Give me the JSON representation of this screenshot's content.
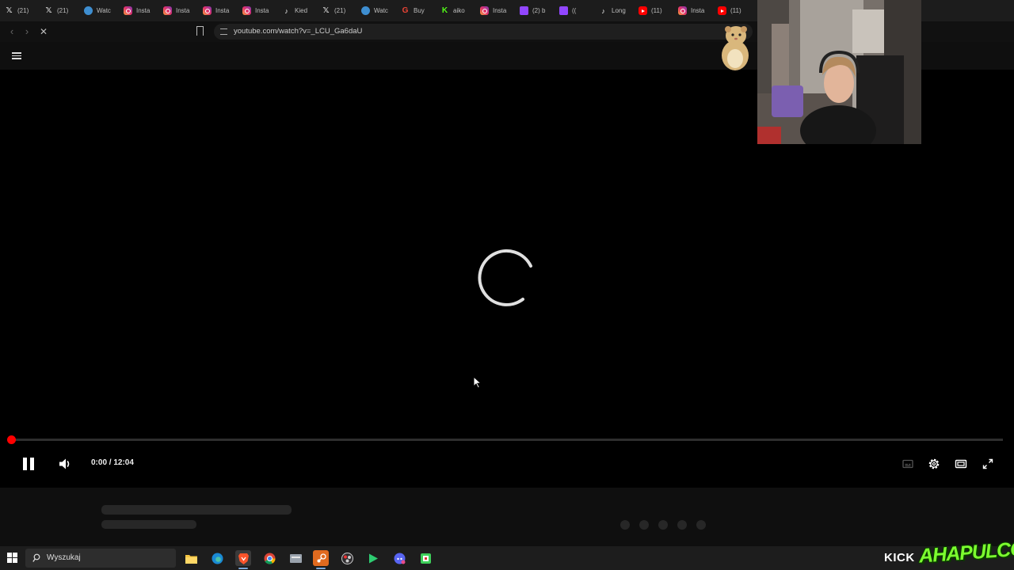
{
  "browser": {
    "tabs": [
      {
        "icon": "x-icon",
        "label": "(21)"
      },
      {
        "icon": "x-icon",
        "label": "(21)"
      },
      {
        "icon": "watch-icon",
        "label": "Watc"
      },
      {
        "icon": "instagram-icon",
        "label": "Insta"
      },
      {
        "icon": "instagram-icon",
        "label": "Insta"
      },
      {
        "icon": "instagram-icon",
        "label": "Insta"
      },
      {
        "icon": "instagram-icon",
        "label": "Insta"
      },
      {
        "icon": "tiktok-icon",
        "label": "Kied"
      },
      {
        "icon": "x-icon",
        "label": "(21)"
      },
      {
        "icon": "watch-icon",
        "label": "Watc"
      },
      {
        "icon": "google-icon",
        "label": "Buy"
      },
      {
        "icon": "kick-icon",
        "label": "aiko"
      },
      {
        "icon": "instagram-icon",
        "label": "Insta"
      },
      {
        "icon": "twitch-icon",
        "label": "(2) b"
      },
      {
        "icon": "twitch-icon",
        "label": "(("
      },
      {
        "icon": "tiktok-icon",
        "label": "Long"
      },
      {
        "icon": "youtube-icon",
        "label": "(11)"
      },
      {
        "icon": "instagram-icon",
        "label": "Insta"
      },
      {
        "icon": "youtube-icon",
        "label": "(11)"
      }
    ],
    "url": "youtube.com/watch?v=_LCU_Ga6daU"
  },
  "player": {
    "time": "0:00 / 12:04",
    "progress_fraction": 0,
    "accent_color": "#ff0000",
    "loading": true
  },
  "taskbar": {
    "search_placeholder": "Wyszukaj",
    "apps": [
      "file-explorer-icon",
      "edge-icon",
      "brave-icon",
      "chrome-icon",
      "file-manager-icon",
      "steam-icon",
      "obs-icon",
      "play-icon",
      "discord-icon",
      "app-icon"
    ]
  },
  "overlay": {
    "kick_label": "KICK",
    "kick_channel": "AHAPULCO"
  }
}
